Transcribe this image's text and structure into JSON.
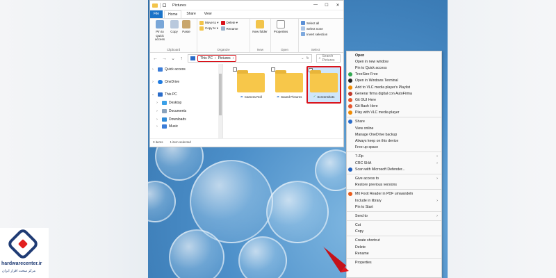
{
  "explorer": {
    "window_title": "Pictures",
    "tabs": [
      "File",
      "Home",
      "Share",
      "View"
    ],
    "ribbon": {
      "clipboard": {
        "label": "Clipboard",
        "pin": "Pin to Quick access",
        "copy": "Copy",
        "paste": "Paste"
      },
      "organize": {
        "label": "Organize",
        "move_to": "Move to ▾",
        "copy_to": "Copy to ▾",
        "delete": "Delete ▾",
        "rename": "Rename"
      },
      "new": {
        "label": "New",
        "new_folder": "New folder"
      },
      "open": {
        "label": "Open",
        "properties": "Properties"
      },
      "select": {
        "label": "Select",
        "select_all": "Select all",
        "select_none": "Select none",
        "invert": "Invert selection"
      }
    },
    "address": {
      "root": "This PC",
      "sep": "›",
      "folder": "Pictures"
    },
    "search_placeholder": "Search Pictures",
    "nav": [
      {
        "label": "Quick access",
        "caret": "›"
      },
      {
        "label": "OneDrive",
        "caret": "›"
      },
      {
        "label": "This PC",
        "caret": "⌄"
      },
      {
        "label": "Desktop",
        "caret": "›"
      },
      {
        "label": "Documents",
        "caret": "›"
      },
      {
        "label": "Downloads",
        "caret": "›"
      },
      {
        "label": "Music",
        "caret": "›"
      }
    ],
    "folders": [
      "Camera Roll",
      "Saved Pictures",
      "Screenshots"
    ],
    "status": {
      "items": "3 items",
      "selected": "1 item selected"
    },
    "window_controls": {
      "min": "—",
      "max": "☐",
      "close": "✕"
    }
  },
  "context_menu": {
    "groups": [
      [
        {
          "label": "Open",
          "bold": true
        },
        {
          "label": "Open in new window"
        },
        {
          "label": "Pin to Quick access"
        },
        {
          "label": "TreeSize Free",
          "icon_color": "#2fa84f"
        },
        {
          "label": "Open in Windows Terminal",
          "icon_color": "#222222"
        },
        {
          "label": "Add to VLC media player's Playlist",
          "icon_color": "#f08a00"
        },
        {
          "label": "Generar firma digital con AutoFirma",
          "icon_color": "#c0392b"
        },
        {
          "label": "Git GUI Here",
          "icon_color": "#e4572e"
        },
        {
          "label": "Git Bash Here",
          "icon_color": "#e4572e"
        },
        {
          "label": "Play with VLC media player",
          "icon_color": "#f08a00"
        }
      ],
      [
        {
          "label": "Share",
          "icon_color": "#2a6cc9"
        },
        {
          "label": "View online"
        },
        {
          "label": "Manage OneDrive backup"
        },
        {
          "label": "Always keep on this device"
        },
        {
          "label": "Free up space"
        }
      ],
      [
        {
          "label": "7-Zip",
          "arrow": "›"
        },
        {
          "label": "CRC SHA",
          "arrow": "›"
        },
        {
          "label": "Scan with Microsoft Defender...",
          "icon_color": "#1f5fbf"
        }
      ],
      [
        {
          "label": "Give access to",
          "arrow": "›"
        },
        {
          "label": "Restore previous versions"
        }
      ],
      [
        {
          "label": "Mit Foxit Reader in PDF umwandeln",
          "icon_color": "#e85b1a"
        },
        {
          "label": "Include in library",
          "arrow": "›"
        },
        {
          "label": "Pin to Start"
        }
      ],
      [
        {
          "label": "Send to",
          "arrow": "›"
        }
      ],
      [
        {
          "label": "Cut"
        },
        {
          "label": "Copy"
        }
      ],
      [
        {
          "label": "Create shortcut"
        },
        {
          "label": "Delete"
        },
        {
          "label": "Rename"
        }
      ],
      [
        {
          "label": "Properties"
        }
      ]
    ]
  },
  "logo": {
    "title": "hardwarecenter.ir",
    "subtitle": "مرکز سخت افزار ایران"
  }
}
